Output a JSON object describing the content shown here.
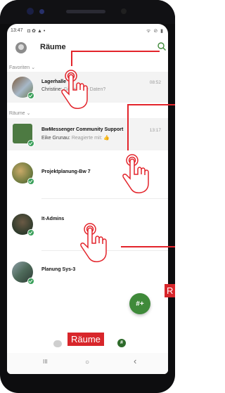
{
  "status_bar": {
    "time": "13:47",
    "icons": "◘ ✿ ▲ •",
    "right_icons": "ᯤ ⊘ ▮"
  },
  "app_bar": {
    "title": "Räume"
  },
  "sections": {
    "favorites": "Favoriten",
    "rooms": "Räume",
    "chevron": "⌄"
  },
  "rooms": [
    {
      "title": "Lagerhalle",
      "sender": "Christine",
      "message": "Gibt's neue Daten?",
      "time": "08:52"
    },
    {
      "title": "BwMessenger Community Support",
      "sender": "Eike Grunau",
      "message": "Reagierte mit: 👍",
      "time": "13:17"
    },
    {
      "title": "Projektplanung-Bw 7"
    },
    {
      "title": "It-Admins"
    },
    {
      "title": "Planung Sys-3"
    }
  ],
  "fab": {
    "label": "#+"
  },
  "bottom_nav": {
    "rooms_icon": "#"
  },
  "system_nav": {
    "recent": "III",
    "home": "○",
    "back": "‹"
  },
  "labels": {
    "rooms_nav": "Räume",
    "fab_edge": "R"
  },
  "colors": {
    "accent_red": "#e3242b",
    "brand_green": "#3f8a3a",
    "badge_green": "#3aa05a"
  }
}
